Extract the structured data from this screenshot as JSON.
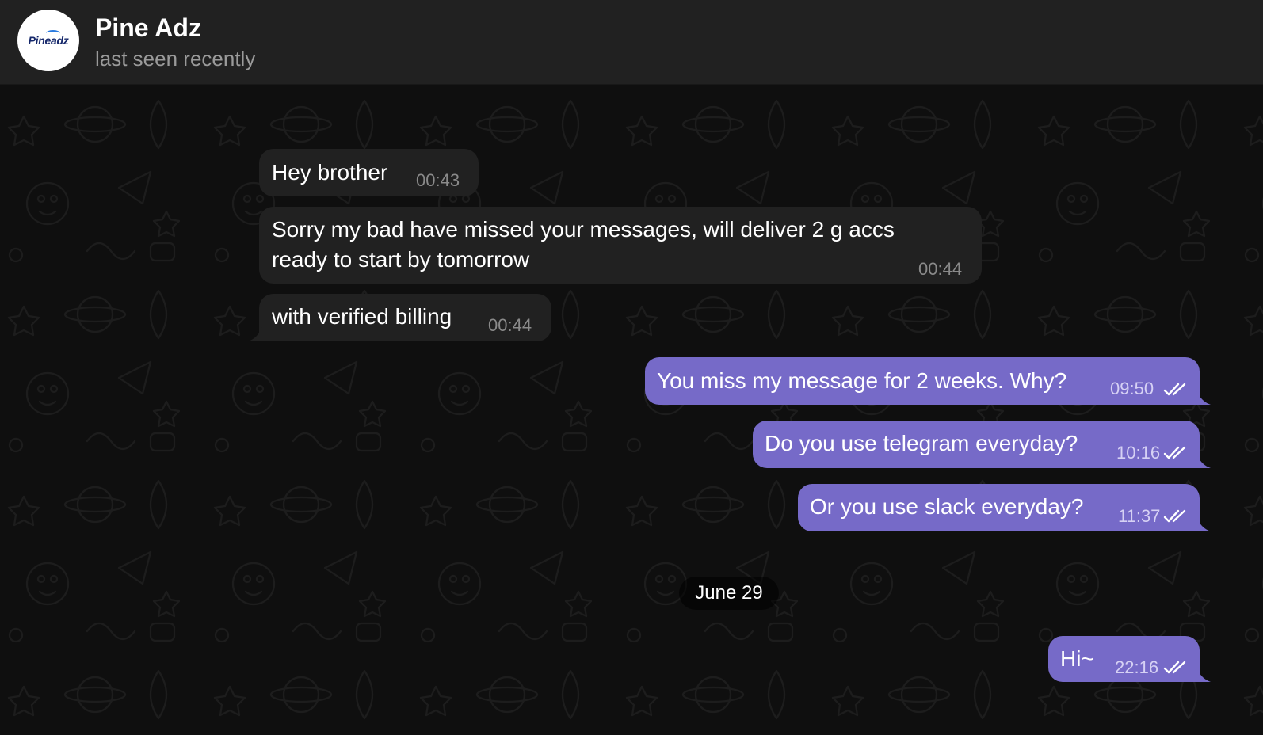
{
  "header": {
    "avatar_logo": "Pineadz",
    "title": "Pine Adz",
    "status": "last seen recently"
  },
  "messages": [
    {
      "direction": "incoming",
      "text": "Hey brother",
      "time": "00:43"
    },
    {
      "direction": "incoming",
      "text_lines": [
        "Sorry my bad have missed your messages, will deliver 2 g accs",
        "ready to start by tomorrow"
      ],
      "time": "00:44"
    },
    {
      "direction": "incoming",
      "text": "with verified billing",
      "time": "00:44"
    },
    {
      "direction": "outgoing",
      "text": "You miss my message for 2 weeks. Why?",
      "time": "09:50",
      "status_icon": "double-check-icon"
    },
    {
      "direction": "outgoing",
      "text": "Do you use telegram everyday?",
      "time": "10:16",
      "status_icon": "double-check-icon"
    },
    {
      "direction": "outgoing",
      "text": "Or you use slack everyday?",
      "time": "11:37",
      "status_icon": "double-check-icon"
    },
    {
      "direction": "outgoing",
      "text": "Hi~",
      "time": "22:16",
      "status_icon": "double-check-icon"
    }
  ],
  "date_separator": "June 29",
  "colors": {
    "header_bg": "#212121",
    "chat_bg": "#0f0f0f",
    "incoming_bubble": "#212121",
    "outgoing_bubble": "#766ac8"
  }
}
